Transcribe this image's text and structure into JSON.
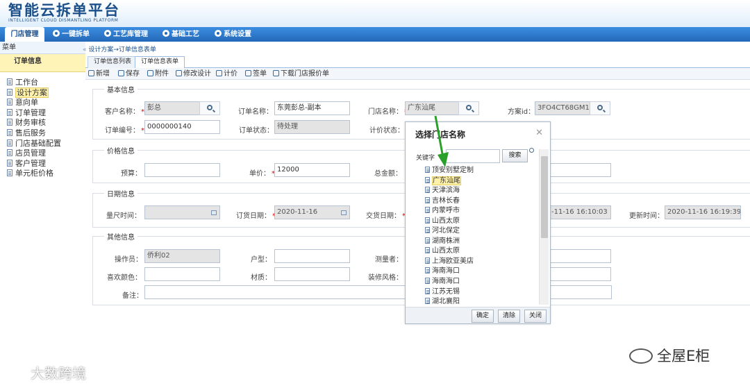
{
  "app": {
    "logo_main": "智能云拆单平台",
    "logo_sub": "INTELLIGENT CLOUD DISMANTLING PLATFORM"
  },
  "nav": [
    "门店管理",
    "一键拆单",
    "工艺库管理",
    "基础工艺",
    "系统设置"
  ],
  "sidebar": {
    "menu_label": "菜单",
    "header": "订单信息",
    "items": [
      "工作台",
      "设计方案",
      "意向单",
      "订单管理",
      "财务审核",
      "售后服务",
      "门店基础配置",
      "店员管理",
      "客户管理",
      "单元柜价格"
    ]
  },
  "breadcrumb": "设计方案→订单信息表单",
  "tabs": [
    "订单信息列表",
    "订单信息表单"
  ],
  "toolbar": [
    "新增",
    "保存",
    "附件",
    "修改设计",
    "计价",
    "签单",
    "下载门店报价单"
  ],
  "sections": {
    "basic": "基本信息",
    "price": "价格信息",
    "date": "日期信息",
    "other": "其他信息"
  },
  "form": {
    "customer_label": "客户名称：",
    "customer_value": "彭总",
    "order_name_label": "订单名称：",
    "order_name_value": "东莞彭总-副本",
    "store_label": "门店名称：",
    "store_value": "广东汕尾",
    "plan_id_label": "方案id：",
    "plan_id_value": "3FO4CT68GM1C",
    "order_no_label": "订单编号：",
    "order_no_value": "0000000140",
    "order_status_label": "订单状态：",
    "order_status_value": "待处理",
    "pricing_status_label": "计价状态：",
    "budget_label": "预算：",
    "unit_price_label": "单价：",
    "unit_price_value": "12000",
    "total_label": "总金额：",
    "measure_time_label": "量尺时间：",
    "order_date_label": "订货日期：",
    "order_date_value": "2020-11-16",
    "delivery_date_label": "交货日期：",
    "create_time_value": "-11-16 16:10:03",
    "update_time_label": "更新时间：",
    "update_time_value": "2020-11-16 16:19:39",
    "operator_label": "操作员：",
    "operator_value": "侨利02",
    "house_type_label": "户型：",
    "measurer_label": "测量者：",
    "color_label": "喜欢颜色：",
    "material_label": "材质：",
    "style_label": "装修风格：",
    "remark_label": "备注："
  },
  "dialog": {
    "title": "选择门店名称",
    "keyword_label": "关键字",
    "search_btn": "搜索",
    "stores": [
      "顶安别墅定制",
      "广东汕尾",
      "天津滨海",
      "吉林长春",
      "内蒙呼市",
      "山西太原",
      "河北保定",
      "湖南株洲",
      "山西太原",
      "上海欧亚美店",
      "海南海口",
      "海南海口",
      "江苏无锡",
      "湖北襄阳"
    ],
    "selected_index": 1,
    "confirm": "确定",
    "clear": "清除",
    "close": "关闭"
  },
  "watermarks": {
    "left": "大数跨境",
    "right": "全屋E柜"
  },
  "colors": {
    "nav_bg": "#2468b8",
    "accent": "#1b4f8a",
    "arrow": "#2aa02a",
    "required": "#dd0000"
  }
}
